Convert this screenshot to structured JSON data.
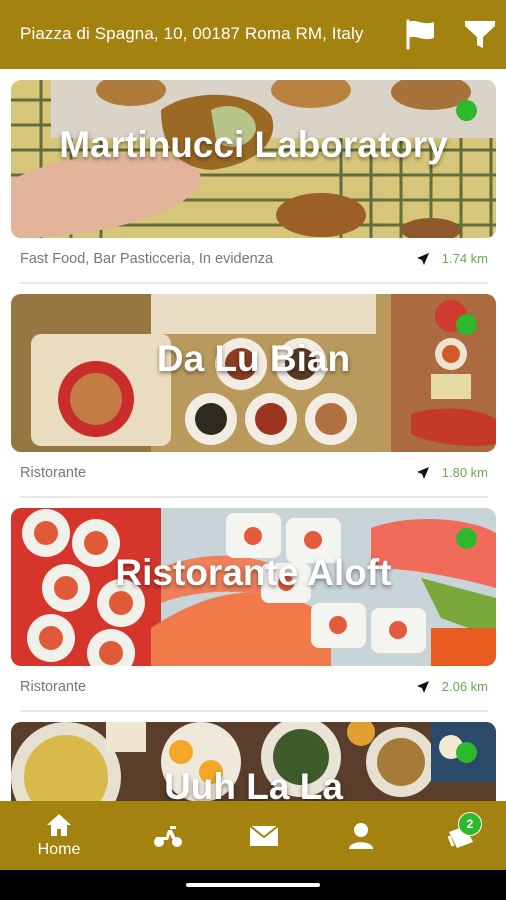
{
  "header": {
    "address": "Piazza di Spagna, 10, 00187 Roma RM, Italy",
    "language_icon": "flag-icon",
    "filter_icon": "filter-icon"
  },
  "restaurants": [
    {
      "name": "Martinucci Laboratory",
      "category": "Fast Food, Bar Pasticceria, In evidenza",
      "distance": "1.74 km",
      "status_color": "#2db82d"
    },
    {
      "name": "Da Lu Bian",
      "category": "Ristorante",
      "distance": "1.80 km",
      "status_color": "#2db82d"
    },
    {
      "name": "Ristorante Aloft",
      "category": "Ristorante",
      "distance": "2.06 km",
      "status_color": "#2db82d"
    },
    {
      "name": "Uuh La La",
      "category": "",
      "distance": "",
      "status_color": "#2db82d"
    }
  ],
  "bottom_nav": {
    "home_label": "Home",
    "cart_badge": "2",
    "icons": [
      "home-icon",
      "scooter-icon",
      "mail-icon",
      "user-icon",
      "cart-icon"
    ]
  },
  "colors": {
    "brand": "#a4820f",
    "status_open": "#2db82d",
    "distance_text": "#6aa84f"
  }
}
